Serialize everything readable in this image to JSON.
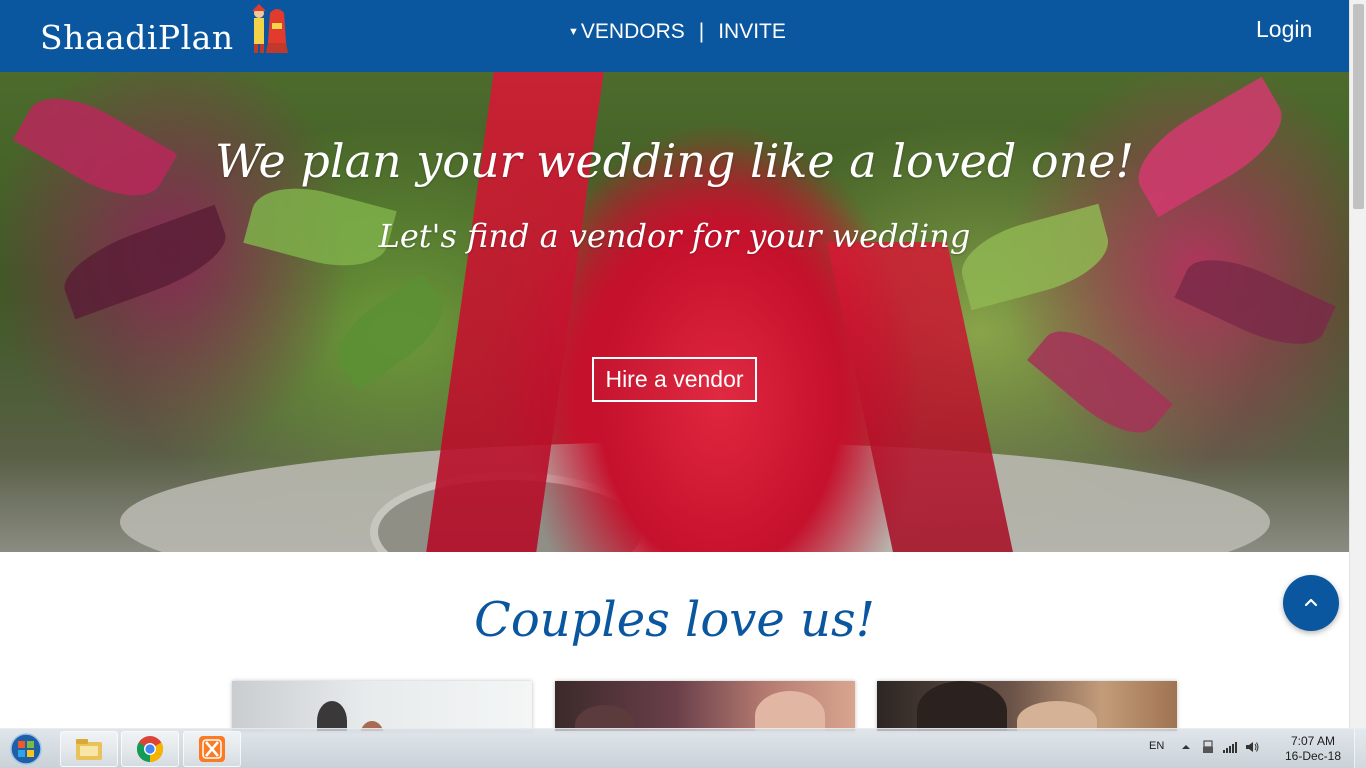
{
  "navbar": {
    "brand": "ShaadiPlan",
    "logo_icon": "bride-groom-icon",
    "vendors_label": "VENDORS",
    "separator": "|",
    "invite_label": "INVITE",
    "login_label": "Login",
    "background_color": "#0b579f"
  },
  "hero": {
    "title": "We plan your wedding like a loved one!",
    "subtitle": "Let's find a vendor for your wedding",
    "cta_label": "Hire a vendor"
  },
  "couples": {
    "title": "Couples love us!",
    "cards": [
      {
        "image": "couple-photo-1"
      },
      {
        "image": "couple-photo-2"
      },
      {
        "image": "couple-photo-3"
      }
    ]
  },
  "scroll_top": {
    "icon": "chevron-up-icon"
  },
  "taskbar": {
    "start_icon": "windows-start-icon",
    "pinned": [
      {
        "icon": "file-explorer-icon"
      },
      {
        "icon": "chrome-icon"
      },
      {
        "icon": "xampp-icon"
      }
    ],
    "language": "EN",
    "tray_icons": [
      "show-hidden-icons-icon",
      "network-adapter-icon",
      "signal-strength-icon",
      "volume-icon"
    ],
    "time": "7:07 AM",
    "date": "16-Dec-18"
  },
  "colors": {
    "primary": "#0b579f",
    "hero_red": "#c8102e",
    "text_on_dark": "#ffffff"
  }
}
